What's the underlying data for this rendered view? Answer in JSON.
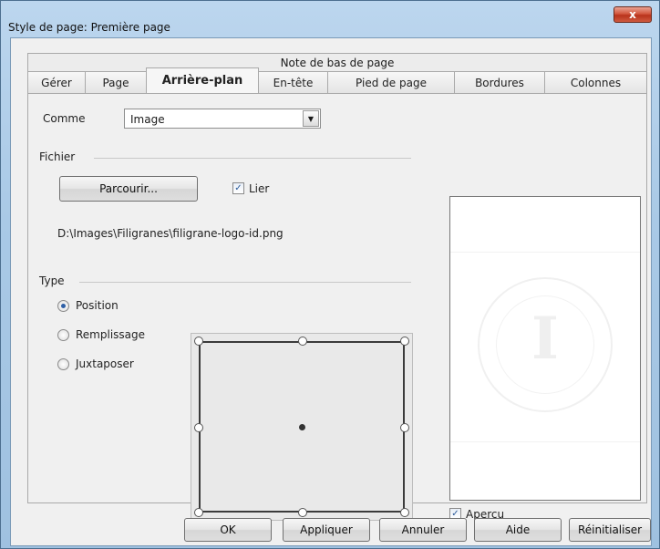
{
  "window": {
    "title": "Style de page: Première page",
    "close_glyph": "x"
  },
  "tabs": {
    "top_row": "Note de bas de page",
    "items": [
      {
        "label": "Gérer"
      },
      {
        "label": "Page"
      },
      {
        "label": "Arrière-plan",
        "active": true
      },
      {
        "label": "En-tête"
      },
      {
        "label": "Pied de page"
      },
      {
        "label": "Bordures"
      },
      {
        "label": "Colonnes"
      }
    ]
  },
  "background": {
    "as_label": "Comme",
    "as_value": "Image",
    "file_group": "Fichier",
    "browse_button": "Parcourir...",
    "link_label": "Lier",
    "link_checked": true,
    "file_path": "D:\\Images\\Filigranes\\filigrane-logo-id.png",
    "type_group": "Type",
    "type_options": [
      {
        "label": "Position",
        "selected": true
      },
      {
        "label": "Remplissage",
        "selected": false
      },
      {
        "label": "Juxtaposer",
        "selected": false
      }
    ],
    "preview_label": "Aperçu",
    "preview_checked": true,
    "preview_letter": "I"
  },
  "buttons": {
    "ok": "OK",
    "apply": "Appliquer",
    "cancel": "Annuler",
    "help": "Aide",
    "reset": "Réinitialiser"
  },
  "icons": {
    "close": "close-icon",
    "dropdown": "chevron-down-icon",
    "check": "checkmark-icon"
  }
}
